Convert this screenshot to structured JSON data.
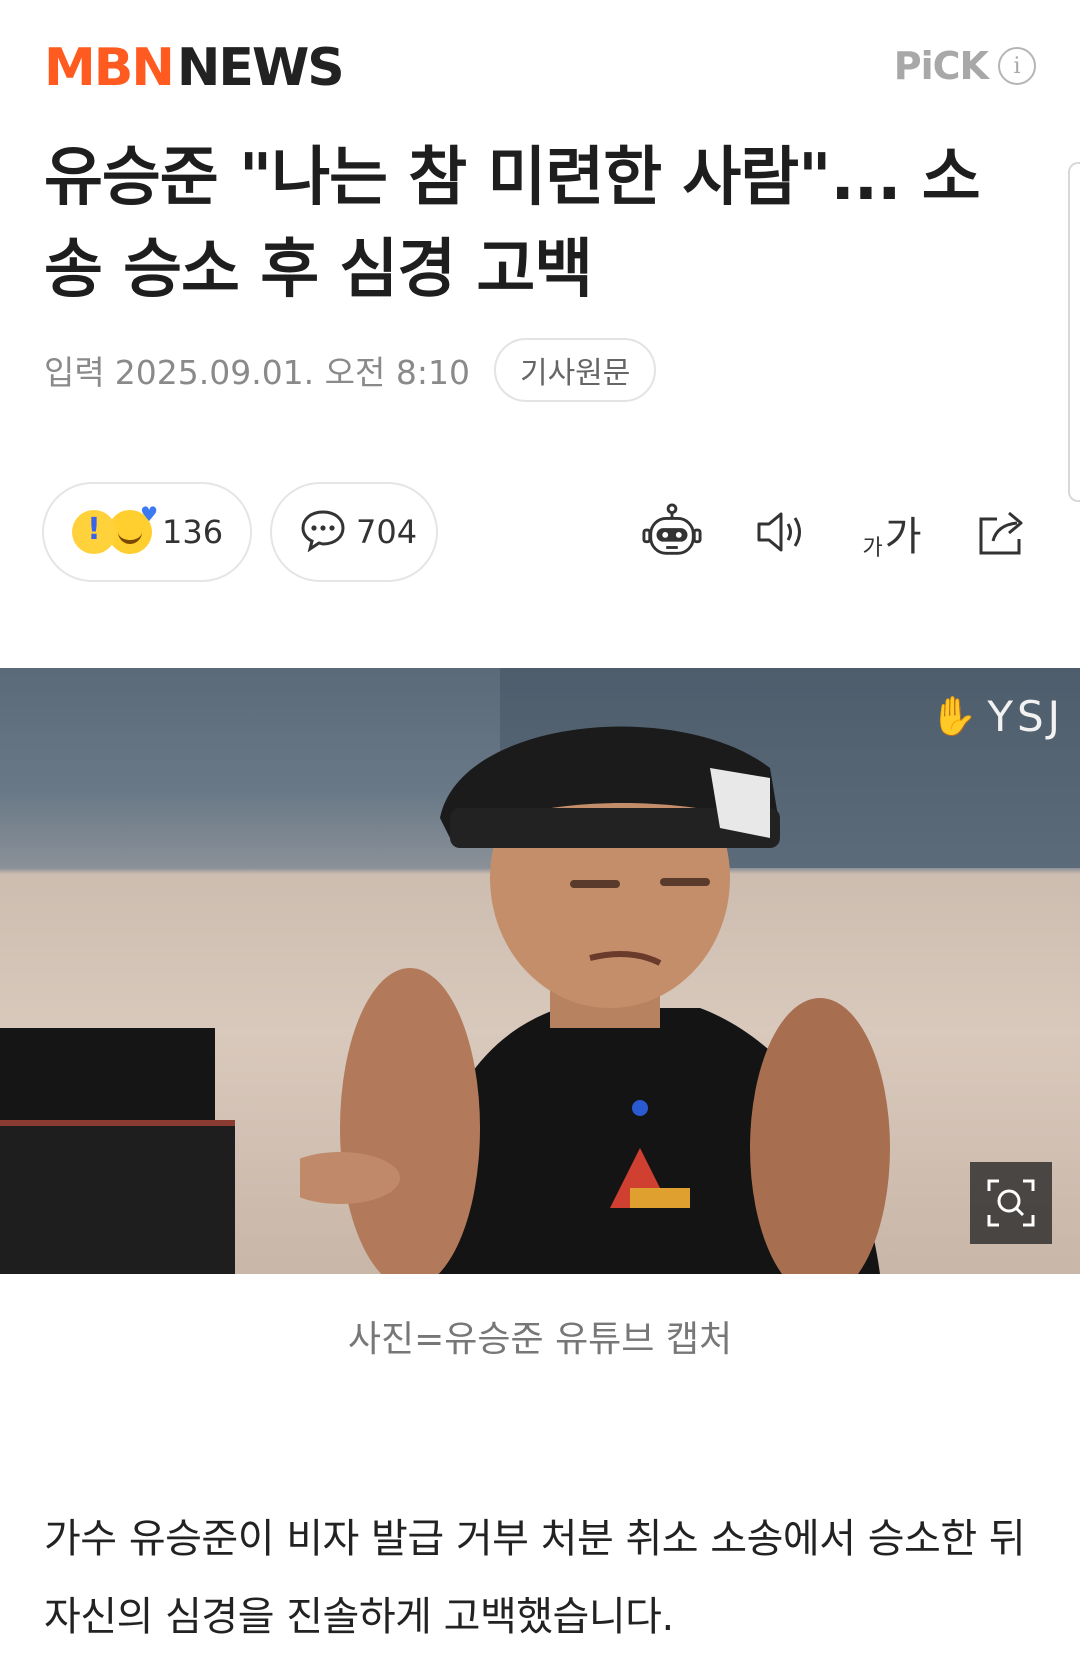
{
  "header": {
    "logo_mbn": "MBN",
    "logo_news": "NEWS",
    "pick_label": "PiCK",
    "pick_info": "i"
  },
  "article": {
    "title": "유승준 \"나는 참 미련한 사람\"... 소송 승소 후 심경 고백",
    "date_label": "입력",
    "date_value": "2025.09.01. 오전 8:10",
    "original_button": "기사원문",
    "reaction_count": "136",
    "comment_count": "704",
    "font_size_small": "가",
    "font_size_large": "가",
    "photo_watermark": "YSJ",
    "photo_caption": "사진=유승준 유튜브 캡처",
    "body_paragraph": "가수 유승준이 비자 발급 거부 처분 취소 소송에서 승소한 뒤 자신의 심경을 진솔하게 고백했습니다."
  },
  "icons": {
    "reaction_emoji_1": "exclamation-face-icon",
    "reaction_emoji_2": "smile-heart-face-icon",
    "comment": "speech-bubble-icon",
    "summary_bot": "robot-icon",
    "text_to_speech": "speaker-icon",
    "font_size": "font-size-icon",
    "share": "share-icon",
    "zoom": "zoom-icon"
  },
  "colors": {
    "brand_orange": "#ff5a1f",
    "text_dark": "#1e1e1e",
    "muted": "#8a8a8a",
    "border": "#e5e5e5"
  }
}
